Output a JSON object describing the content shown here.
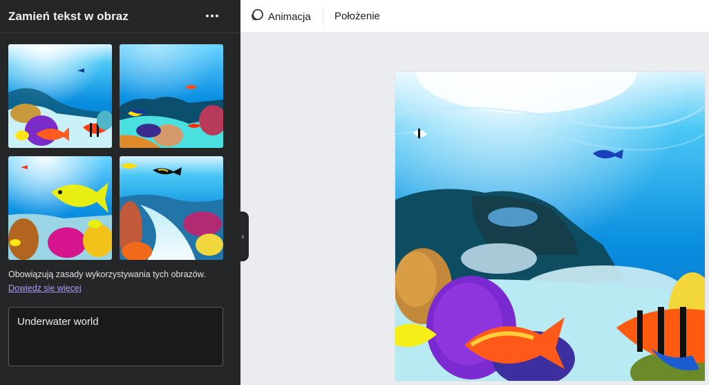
{
  "panel": {
    "title": "Zamień tekst w obraz",
    "more_icon": "more-horizontal-icon",
    "notice": "Obowiązują zasady wykorzystywania tych obrazów.",
    "learn_more": "Dowiedz się więcej",
    "prompt_value": "Underwater world"
  },
  "toolbar": {
    "animation_label": "Animacja",
    "animation_icon": "animation-icon",
    "position_label": "Położenie"
  },
  "collapse": {
    "icon": "chevron-left-icon"
  },
  "colors": {
    "sidebar_bg": "#252627",
    "link": "#a99cf6",
    "canvas_bg": "#ebecf0",
    "toolbar_bg": "#ffffff"
  }
}
